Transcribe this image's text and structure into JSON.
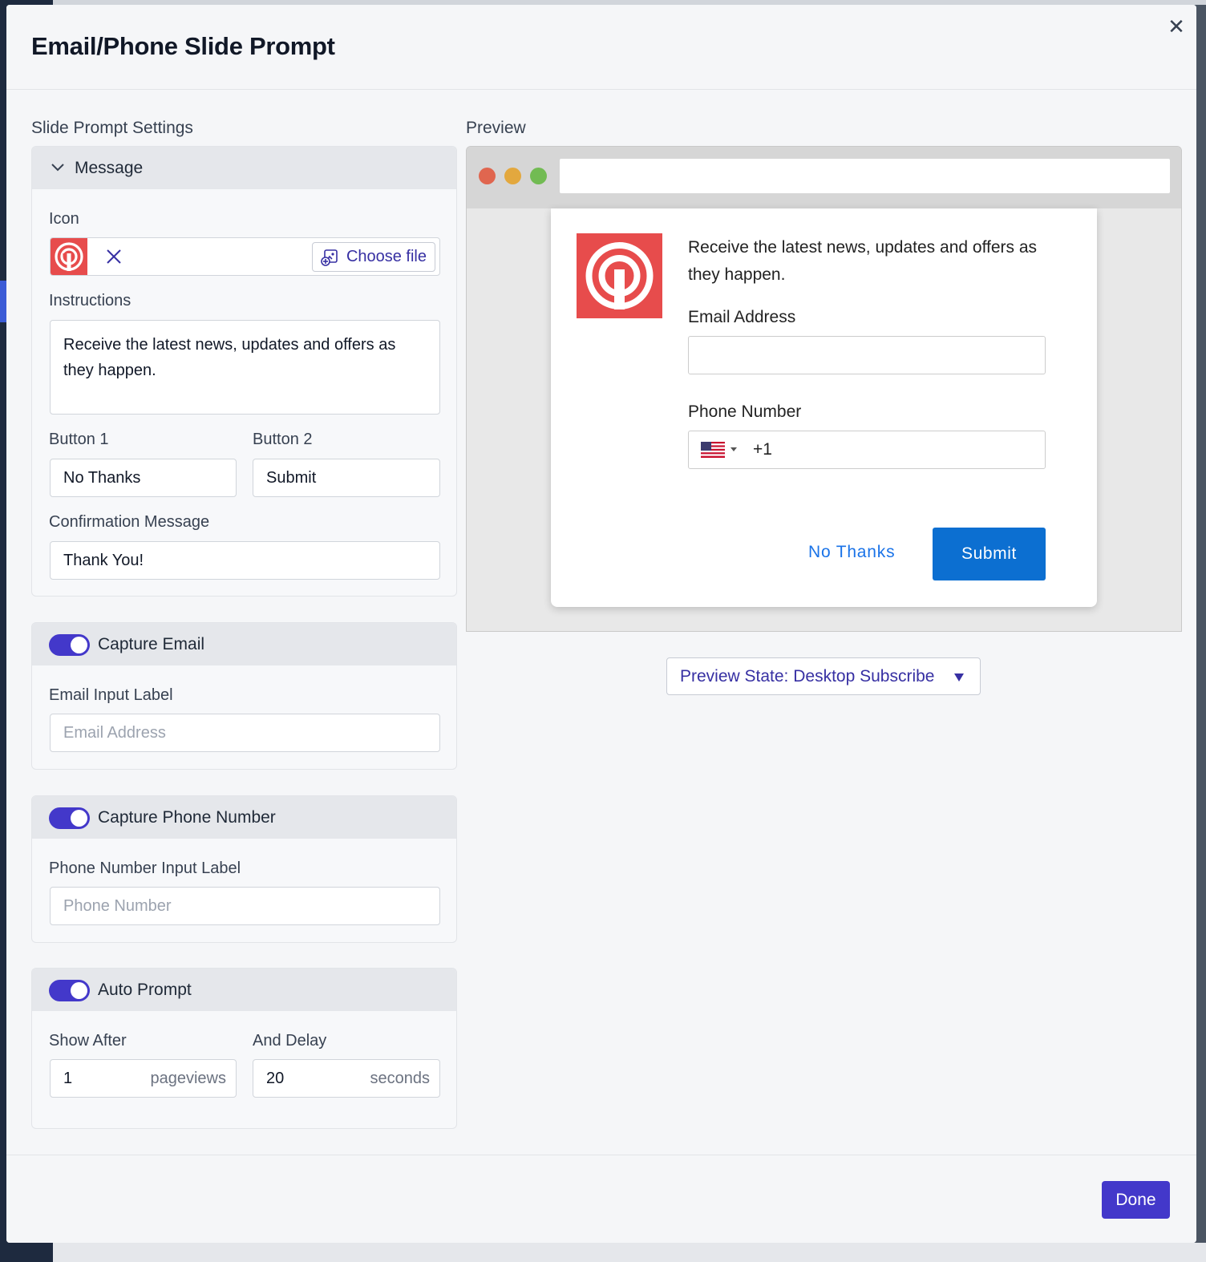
{
  "modal": {
    "title": "Email/Phone Slide Prompt",
    "close_icon": "close-icon",
    "done_label": "Done"
  },
  "settings": {
    "heading": "Slide Prompt Settings",
    "message": {
      "title": "Message",
      "icon_label": "Icon",
      "choose_file_label": "Choose file",
      "instructions_label": "Instructions",
      "instructions_value": "Receive the latest news, updates and offers as they happen.",
      "button1_label": "Button 1",
      "button1_value": "No Thanks",
      "button2_label": "Button 2",
      "button2_value": "Submit",
      "confirmation_label": "Confirmation Message",
      "confirmation_value": "Thank You!"
    },
    "capture_email": {
      "title": "Capture Email",
      "enabled": true,
      "input_label": "Email Input Label",
      "placeholder": "Email Address"
    },
    "capture_phone": {
      "title": "Capture Phone Number",
      "enabled": true,
      "input_label": "Phone Number Input Label",
      "placeholder": "Phone Number"
    },
    "auto_prompt": {
      "title": "Auto Prompt",
      "enabled": true,
      "show_after_label": "Show After",
      "show_after_value": "1",
      "show_after_unit": "pageviews",
      "delay_label": "And Delay",
      "delay_value": "20",
      "delay_unit": "seconds"
    }
  },
  "preview": {
    "heading": "Preview",
    "prompt_text": "Receive the latest news, updates and offers as they happen.",
    "email_label": "Email Address",
    "phone_label": "Phone Number",
    "dial_code": "+1",
    "no_thanks_label": "No Thanks",
    "submit_label": "Submit",
    "state_label": "Preview State: Desktop Subscribe"
  },
  "colors": {
    "accent": "#4338ca",
    "brand_red": "#e74c4c",
    "preview_submit": "#0c6fd1",
    "preview_link": "#1a73e8"
  }
}
